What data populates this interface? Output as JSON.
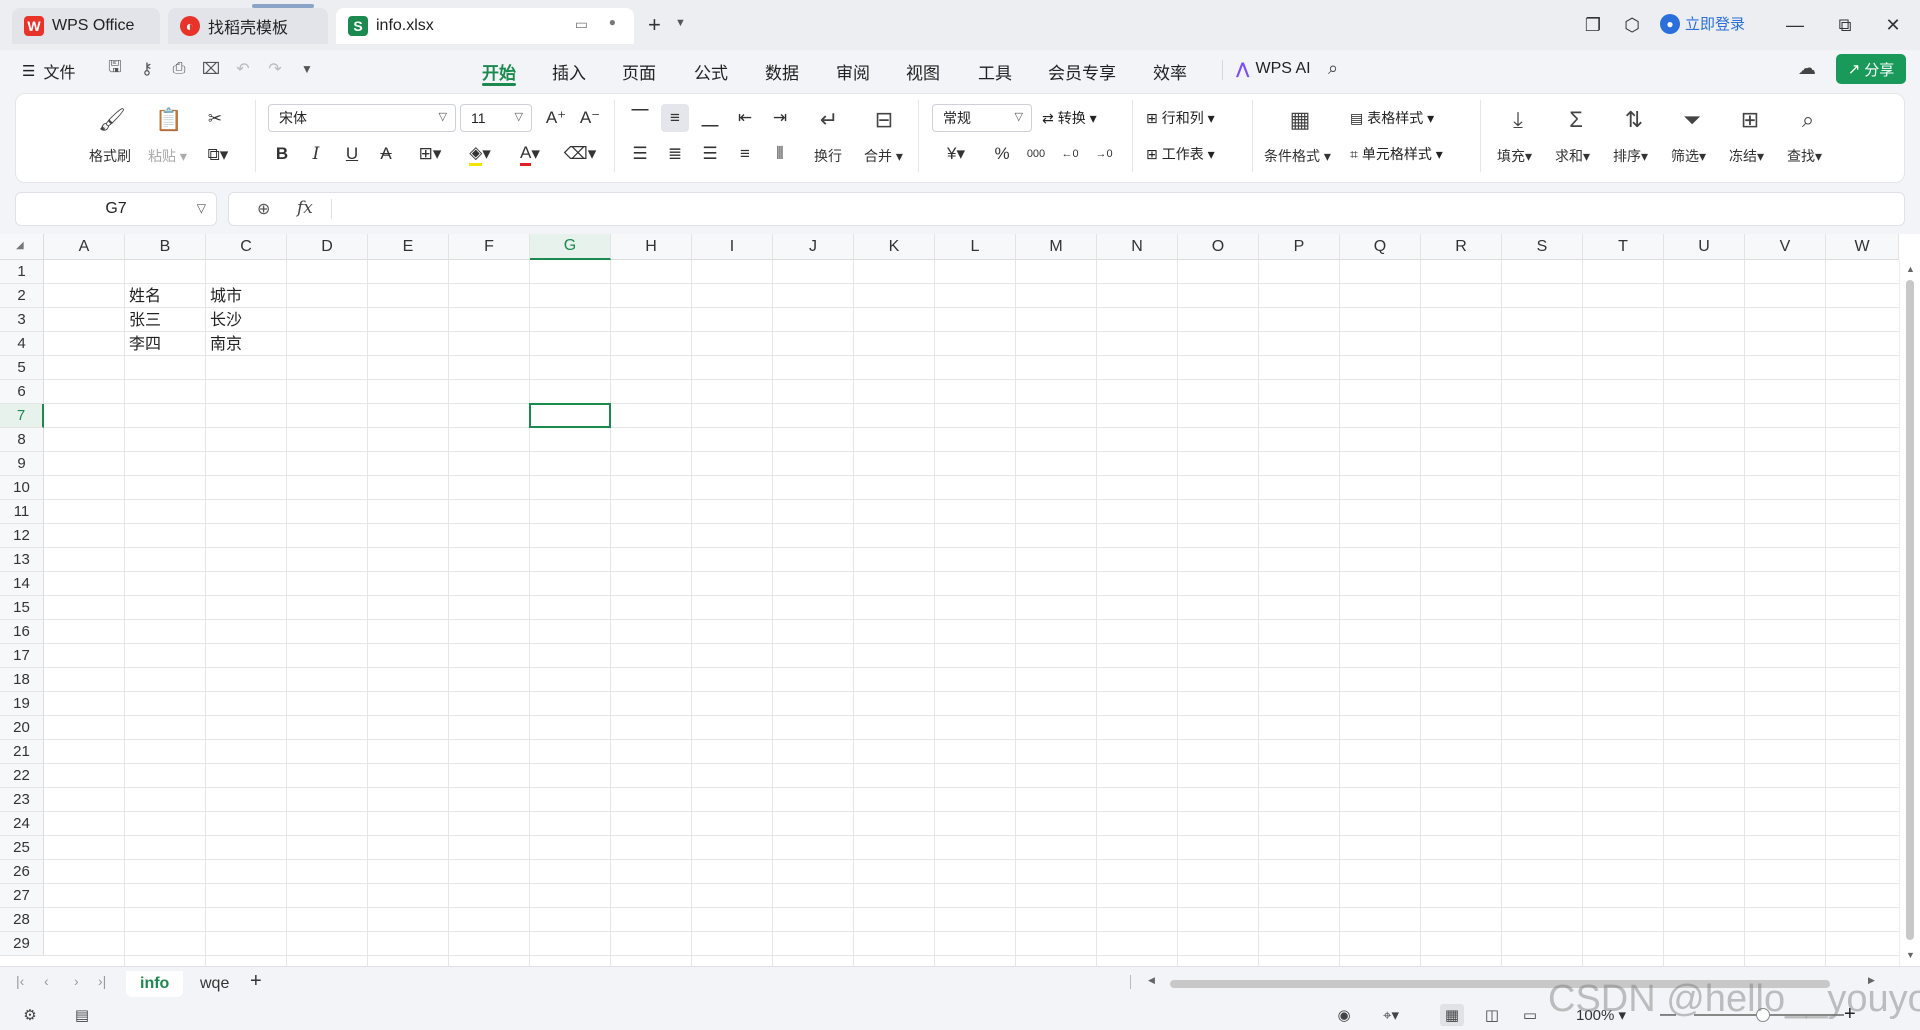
{
  "tabs": [
    {
      "label": "WPS Office",
      "icon": "wps-logo-icon"
    },
    {
      "label": "找稻壳模板",
      "icon": "docer-icon"
    },
    {
      "label": "info.xlsx",
      "icon": "spreadsheet-icon"
    }
  ],
  "login_label": "立即登录",
  "menu": {
    "file": "文件",
    "tabs": [
      "开始",
      "插入",
      "页面",
      "公式",
      "数据",
      "审阅",
      "视图",
      "工具",
      "会员专享",
      "效率"
    ],
    "active_tab": "开始",
    "ai_label": "WPS AI",
    "share_label": "分享"
  },
  "ribbon": {
    "format_painter": "格式刷",
    "paste": "粘贴",
    "font_name": "宋体",
    "font_size": "11",
    "wrap": "换行",
    "merge": "合并",
    "number_format": "常规",
    "convert": "转换",
    "rows_cols": "行和列",
    "worksheet": "工作表",
    "cond_format": "条件格式",
    "table_style": "表格样式",
    "cell_style": "单元格样式",
    "fill": "填充",
    "sum": "求和",
    "sort": "排序",
    "filter": "筛选",
    "freeze": "冻结",
    "find": "查找",
    "currency_symbol": "¥",
    "percent_symbol": "%"
  },
  "namebox": "G7",
  "fx_label": "fx",
  "columns": [
    "A",
    "B",
    "C",
    "D",
    "E",
    "F",
    "G",
    "H",
    "I",
    "J",
    "K",
    "L",
    "M",
    "N",
    "O",
    "P",
    "Q",
    "R",
    "S",
    "T",
    "U",
    "V",
    "W"
  ],
  "rows": [
    "1",
    "2",
    "3",
    "4",
    "5",
    "6",
    "7",
    "8",
    "9",
    "10",
    "11",
    "12",
    "13",
    "14",
    "15",
    "16",
    "17",
    "18",
    "19",
    "20",
    "21",
    "22",
    "23",
    "24",
    "25",
    "26",
    "27",
    "28",
    "29"
  ],
  "selected_cell": {
    "column": "G",
    "row": "7"
  },
  "cells": {
    "B2": "姓名",
    "C2": "城市",
    "B3": "张三",
    "C3": "长沙",
    "B4": "李四",
    "C4": "南京"
  },
  "sheets": [
    "info",
    "wqe"
  ],
  "active_sheet": "info",
  "zoom": "100%",
  "watermark": "CSDN @hello__youyou"
}
